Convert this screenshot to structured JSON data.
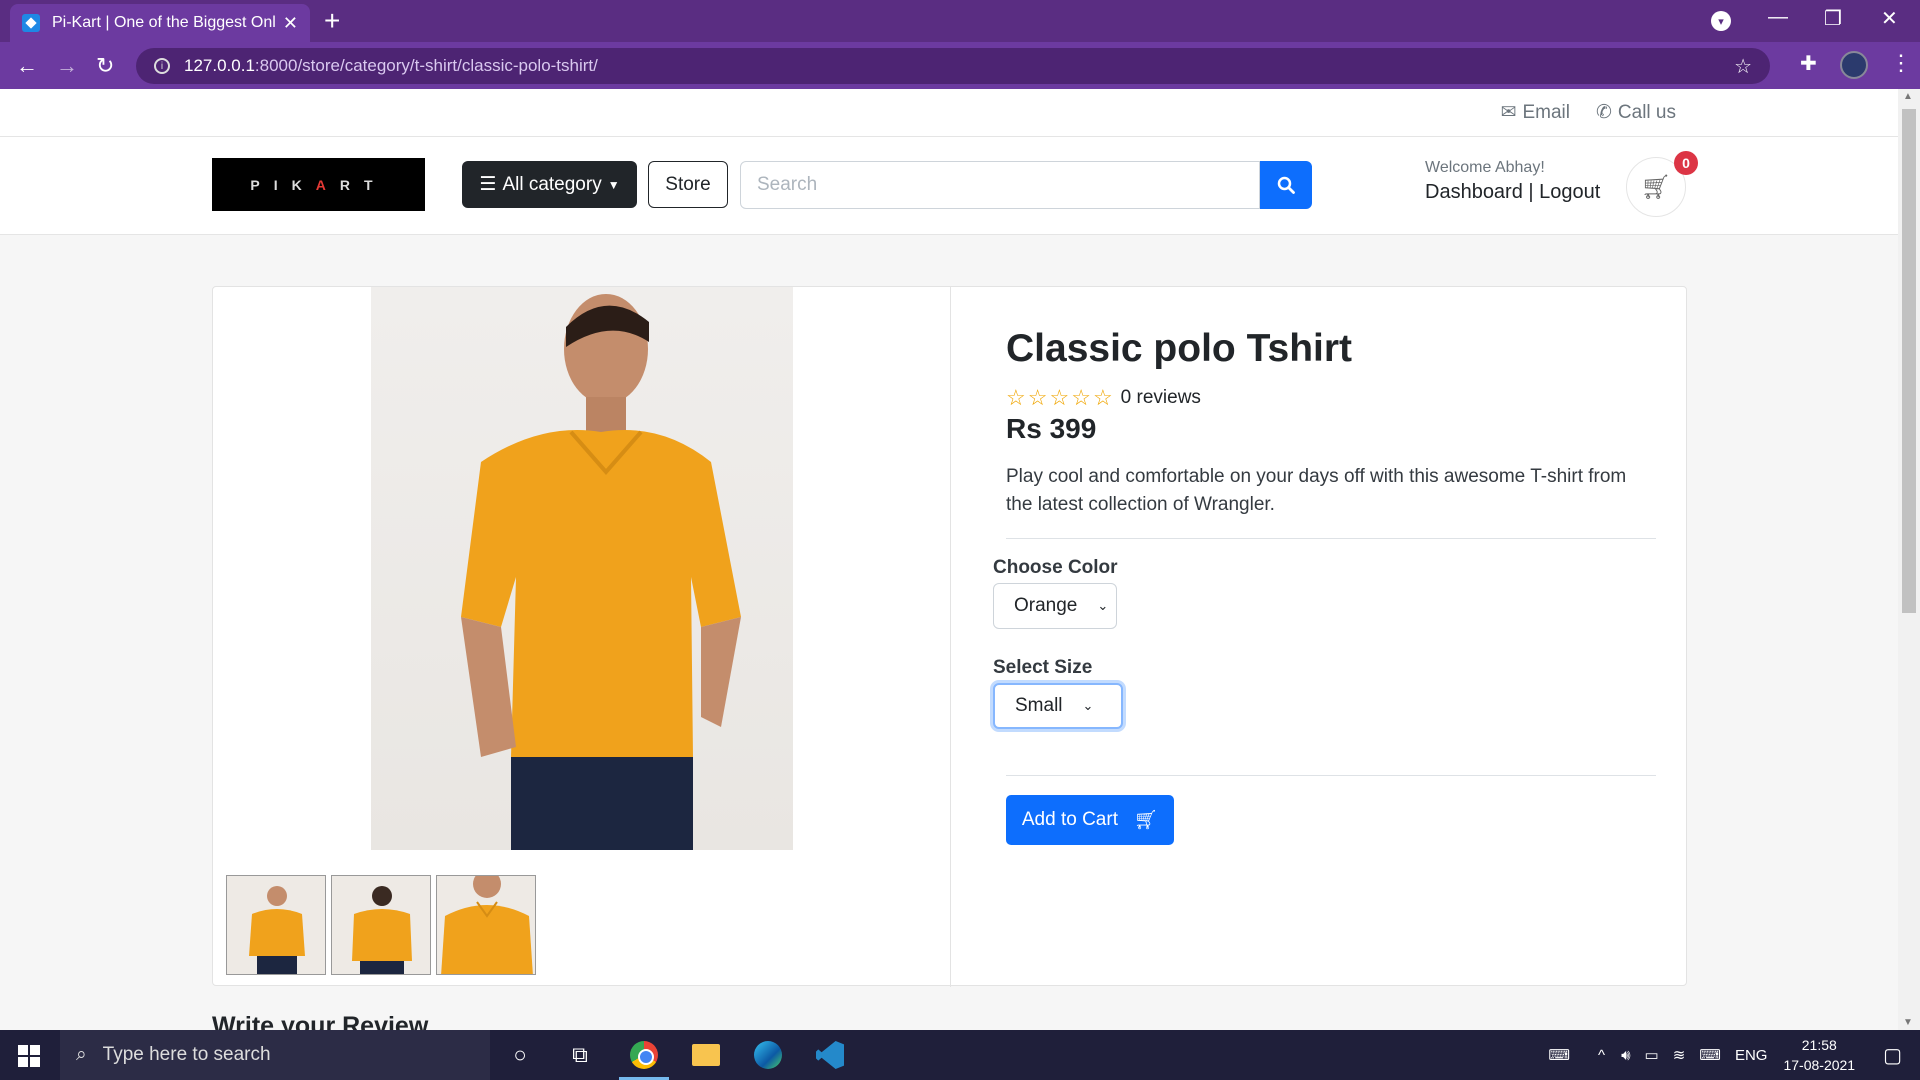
{
  "browser": {
    "tab_title": "Pi-Kart | One of the Biggest Onlin",
    "url_host": "127.0.0.1",
    "url_path": ":8000/store/category/t-shirt/classic-polo-tshirt/"
  },
  "topbar": {
    "email_label": "Email",
    "call_label": "Call us"
  },
  "header": {
    "logo_left": "PIK",
    "logo_mid": "A",
    "logo_right": "RT",
    "category_label": "All category",
    "store_label": "Store",
    "search_placeholder": "Search",
    "welcome": "Welcome Abhay!",
    "dashboard_label": "Dashboard",
    "separator": "|",
    "logout_label": "Logout",
    "cart_count": "0"
  },
  "product": {
    "title": "Classic polo Tshirt",
    "rating_stars": 0,
    "reviews_label": "0 reviews",
    "price": "Rs 399",
    "description": "Play cool and comfortable on your days off with this awesome T-shirt from the latest collection of Wrangler.",
    "color_label": "Choose Color",
    "color_value": "Orange",
    "size_label": "Select Size",
    "size_value": "Small",
    "add_to_cart_label": "Add to Cart",
    "shirt_color": "#f0a21c"
  },
  "review_section_title": "Write your Review",
  "taskbar": {
    "search_placeholder": "Type here to search",
    "language": "ENG",
    "time": "21:58",
    "date": "17-08-2021"
  },
  "colors": {
    "chrome_purple": "#5a2d82",
    "primary_blue": "#0d6efd",
    "dark_button": "#212529",
    "badge_red": "#dc3545"
  }
}
